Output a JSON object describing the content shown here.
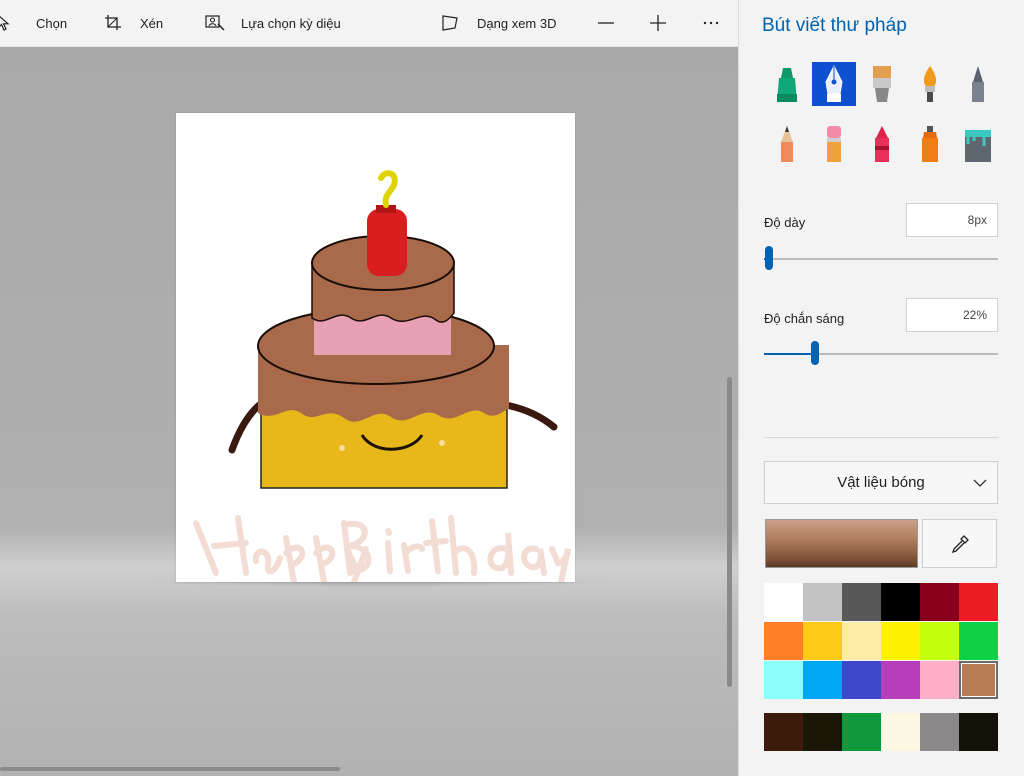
{
  "toolbar": {
    "select_label": "Chọn",
    "crop_label": "Xén",
    "magic_select_label": "Lựa chọn kỳ diệu",
    "view3d_label": "Dạng xem 3D",
    "zoom_out_symbol": "—",
    "zoom_in_symbol": "+",
    "more_symbol": "···"
  },
  "canvas": {
    "drawing_text": "Happy Birthday"
  },
  "panel": {
    "title": "Bút viết thư pháp",
    "brushes": [
      {
        "icon": "marker-icon",
        "selected": false
      },
      {
        "icon": "calligraphy-pen-icon",
        "selected": true
      },
      {
        "icon": "oil-brush-icon",
        "selected": false
      },
      {
        "icon": "watercolor-icon",
        "selected": false
      },
      {
        "icon": "pixel-pen-icon",
        "selected": false
      },
      {
        "icon": "pencil-icon",
        "selected": false
      },
      {
        "icon": "eraser-icon",
        "selected": false
      },
      {
        "icon": "crayon-icon",
        "selected": false
      },
      {
        "icon": "spray-can-icon",
        "selected": false
      },
      {
        "icon": "fill-bucket-icon",
        "selected": false
      }
    ],
    "thickness": {
      "label": "Độ dày",
      "value": "8px",
      "fraction": 0.02
    },
    "opacity": {
      "label": "Độ chắn sáng",
      "value": "22%",
      "fraction": 0.22
    },
    "material_dropdown": "Vật liệu bóng",
    "current_color": "#b47a5a",
    "palette": [
      "#ffffff",
      "#c3c3c3",
      "#585858",
      "#000000",
      "#88001b",
      "#ec1c24",
      "#ff7f27",
      "#ffca18",
      "#fdeca6",
      "#fff200",
      "#c4ff0e",
      "#0ed145",
      "#8cfffb",
      "#00a8f3",
      "#3f48cc",
      "#b83dba",
      "#ffaec8",
      "#b97a56"
    ],
    "selected_palette_index": 17,
    "custom_colors": [
      "#3e1c0c",
      "#1a1608",
      "#0e9a3a",
      "#fdf8e4",
      "#8a8888",
      "#141208"
    ]
  }
}
